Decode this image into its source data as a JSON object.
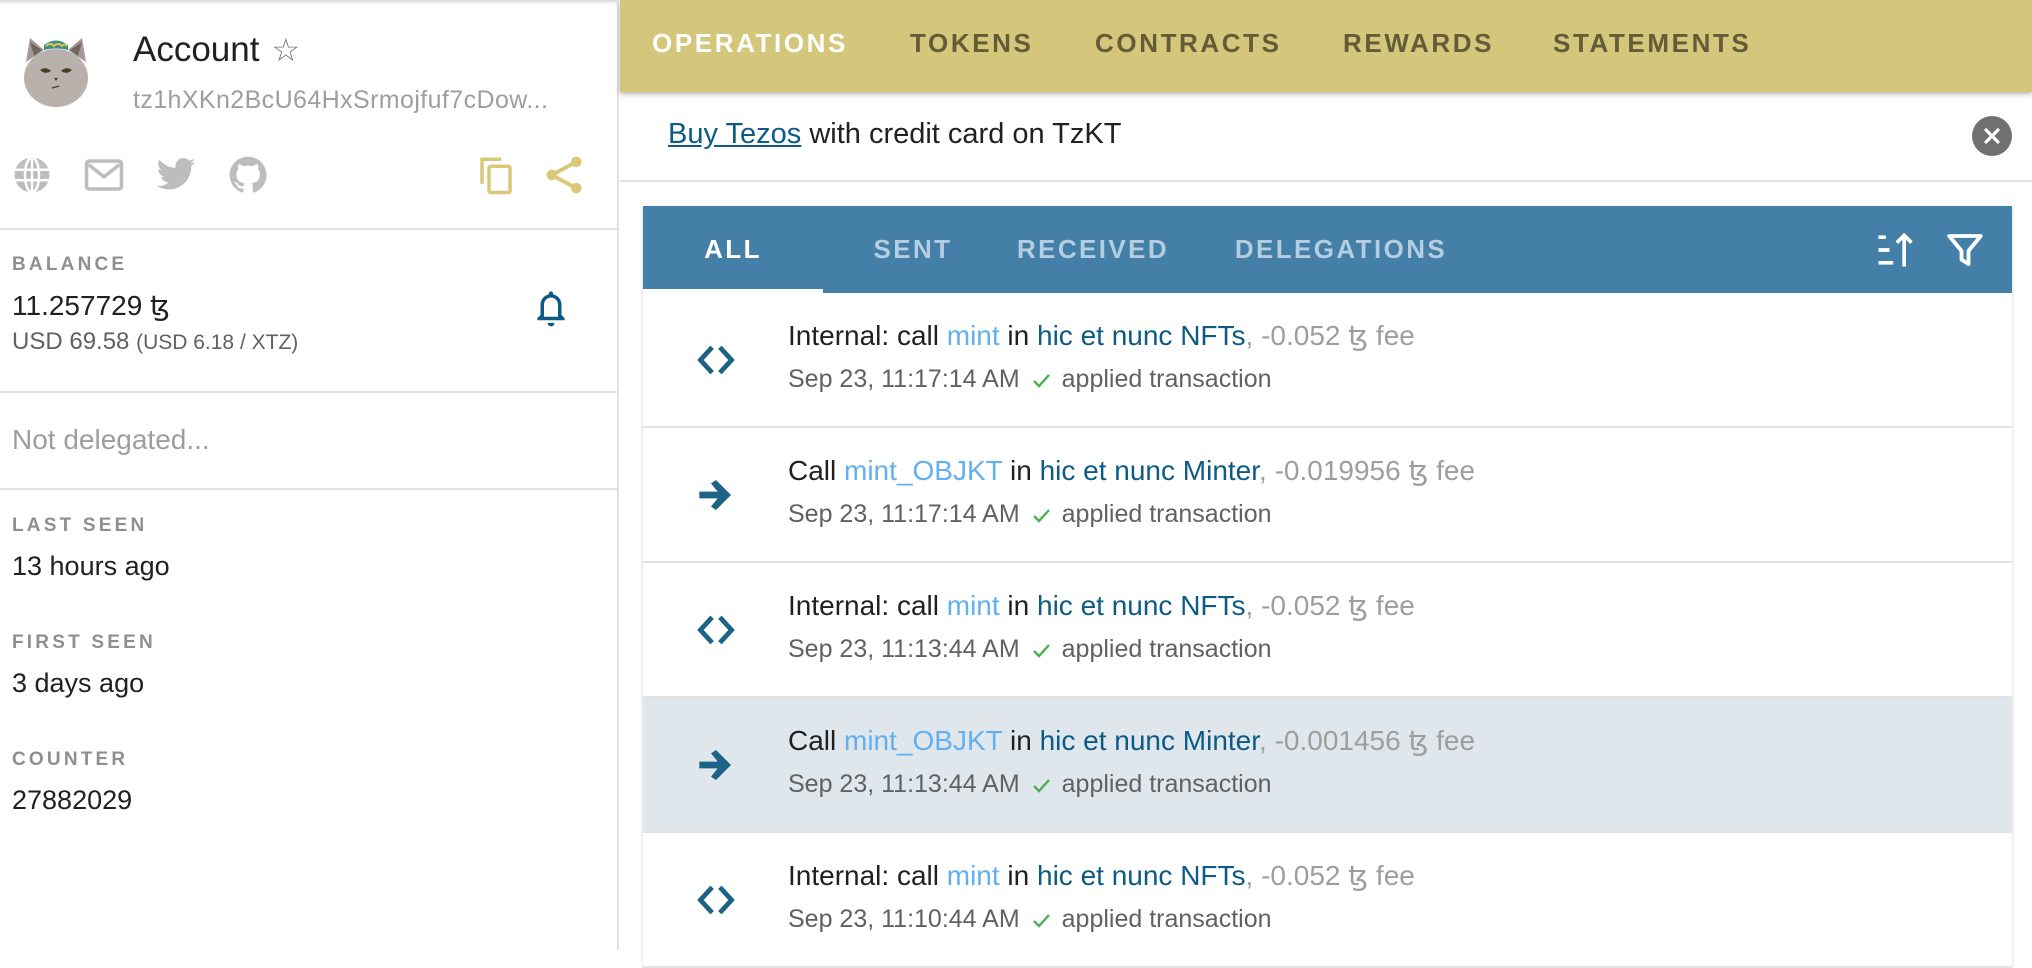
{
  "account": {
    "title": "Account",
    "favorite_icon": "star-outline-icon",
    "address": "tz1hXKn2BcU64HxSrmojfuf7cDow...",
    "social_icons": [
      "globe-icon",
      "mail-icon",
      "twitter-icon",
      "github-icon"
    ],
    "action_icons": [
      "copy-icon",
      "share-icon"
    ]
  },
  "balance": {
    "label": "BALANCE",
    "value": "11.257729 ꜩ",
    "usd": "USD 69.58",
    "rate": "(USD 6.18 / XTZ)",
    "notify_icon": "bell-icon"
  },
  "delegation": {
    "status": "Not delegated..."
  },
  "stats": [
    {
      "label": "LAST SEEN",
      "value": "13 hours ago"
    },
    {
      "label": "FIRST SEEN",
      "value": "3 days ago"
    },
    {
      "label": "COUNTER",
      "value": "27882029"
    }
  ],
  "topnav": {
    "tabs": [
      "OPERATIONS",
      "TOKENS",
      "CONTRACTS",
      "REWARDS",
      "STATEMENTS"
    ],
    "active": "OPERATIONS"
  },
  "banner": {
    "link": "Buy Tezos",
    "text": " with credit card on TzKT",
    "close_icon": "close-circle-icon"
  },
  "op_tabs": {
    "tabs": [
      "ALL",
      "SENT",
      "RECEIVED",
      "DELEGATIONS"
    ],
    "active": "ALL",
    "tools": [
      "sort-ascending-icon",
      "filter-icon"
    ]
  },
  "operations": [
    {
      "icon": "code-brackets-icon",
      "prefix": "Internal: call ",
      "entrypoint": "mint",
      "mid": " in ",
      "contract": "hic et nunc NFTs",
      "fee": ", -0.052 ꜩ fee",
      "time": "Sep 23, 11:17:14 AM",
      "status": "applied transaction",
      "highlight": false
    },
    {
      "icon": "arrow-right-icon",
      "prefix": "Call ",
      "entrypoint": "mint_OBJKT",
      "mid": " in ",
      "contract": "hic et nunc Minter",
      "fee": ", -0.019956 ꜩ fee",
      "time": "Sep 23, 11:17:14 AM",
      "status": "applied transaction",
      "highlight": false
    },
    {
      "icon": "code-brackets-icon",
      "prefix": "Internal: call ",
      "entrypoint": "mint",
      "mid": " in ",
      "contract": "hic et nunc NFTs",
      "fee": ", -0.052 ꜩ fee",
      "time": "Sep 23, 11:13:44 AM",
      "status": "applied transaction",
      "highlight": false
    },
    {
      "icon": "arrow-right-icon",
      "prefix": "Call ",
      "entrypoint": "mint_OBJKT",
      "mid": " in ",
      "contract": "hic et nunc Minter",
      "fee": ", -0.001456 ꜩ fee",
      "time": "Sep 23, 11:13:44 AM",
      "status": "applied transaction",
      "highlight": true
    },
    {
      "icon": "code-brackets-icon",
      "prefix": "Internal: call ",
      "entrypoint": "mint",
      "mid": " in ",
      "contract": "hic et nunc NFTs",
      "fee": ", -0.052 ꜩ fee",
      "time": "Sep 23, 11:10:44 AM",
      "status": "applied transaction",
      "highlight": false
    }
  ],
  "colors": {
    "nav_gold": "#d4c67b",
    "tab_blue": "#437fa6",
    "link_dark": "#0d5b85",
    "entrypoint_blue": "#62b0f0",
    "success_green": "#4caf50",
    "highlight_row": "#dfe7ed"
  }
}
